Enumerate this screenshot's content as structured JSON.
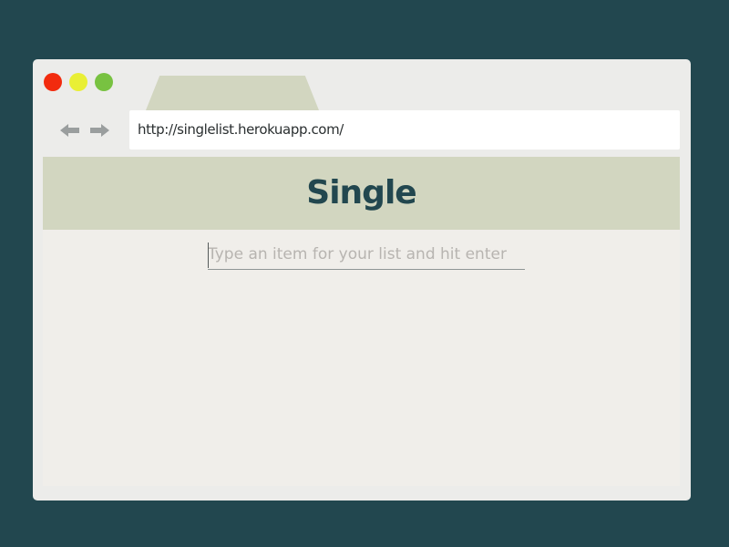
{
  "browser": {
    "url": "http://singlelist.herokuapp.com/",
    "accent_color": "#22474f",
    "header_color": "#d2d6c0"
  },
  "page": {
    "title": "Single",
    "input_placeholder": "Type an item for your list and hit enter",
    "input_value": ""
  },
  "icons": {
    "back": "arrow-left-icon",
    "forward": "arrow-right-icon"
  }
}
